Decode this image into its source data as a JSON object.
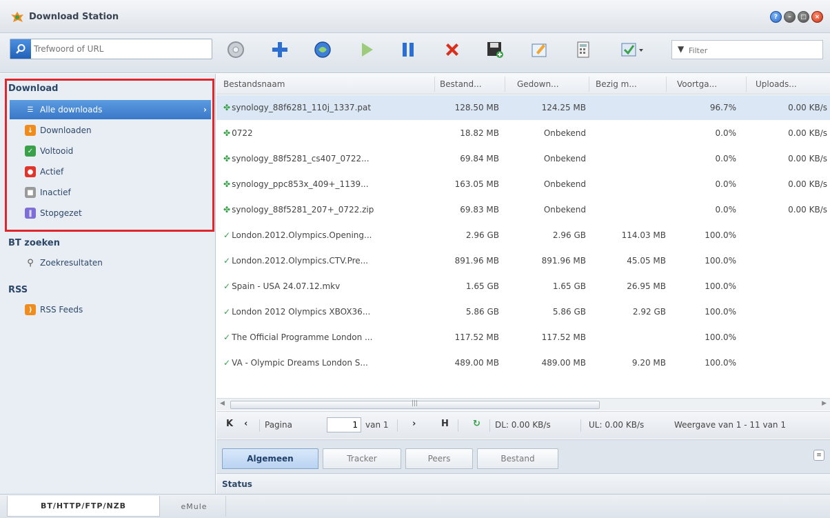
{
  "window": {
    "title": "Download Station",
    "controls": [
      "help",
      "minimize",
      "maximize",
      "close"
    ]
  },
  "toolbar": {
    "search_placeholder": "Trefwoord of URL",
    "filter_placeholder": "Filter",
    "icons": [
      "settings-icon",
      "add-icon",
      "url-icon",
      "resume-icon",
      "pause-icon",
      "delete-icon",
      "save-icon",
      "edit-icon",
      "calculator-icon",
      "select-dropdown-icon"
    ]
  },
  "sidebar": {
    "download": {
      "title": "Download",
      "items": [
        {
          "label": "Alle downloads",
          "icon": "list-icon",
          "color": "#5b9be0"
        },
        {
          "label": "Downloaden",
          "icon": "download-icon",
          "color": "#f08b1d"
        },
        {
          "label": "Voltooid",
          "icon": "check-icon",
          "color": "#3aa14a"
        },
        {
          "label": "Actief",
          "icon": "active-icon",
          "color": "#e0352a"
        },
        {
          "label": "Inactief",
          "icon": "inactive-icon",
          "color": "#9a9a9a"
        },
        {
          "label": "Stopgezet",
          "icon": "pause-icon",
          "color": "#7e6fd6"
        }
      ]
    },
    "bt": {
      "title": "BT zoeken",
      "items": [
        {
          "label": "Zoekresultaten",
          "icon": "search-icon"
        }
      ]
    },
    "rss": {
      "title": "RSS",
      "items": [
        {
          "label": "RSS Feeds",
          "icon": "rss-icon",
          "color": "#f08b1d"
        }
      ]
    }
  },
  "table": {
    "columns": [
      "Bestandsnaam",
      "Bestand...",
      "Gedown...",
      "Bezig m...",
      "Voortga...",
      "Uploads..."
    ],
    "rows": [
      {
        "status": "active",
        "name": "synology_88f6281_110j_1337.pat",
        "size": "128.50 MB",
        "downloaded": "124.25 MB",
        "busy": "",
        "progress": "96.7%",
        "upload": "0.00 KB/s"
      },
      {
        "status": "active",
        "name": "0722",
        "size": "18.82 MB",
        "downloaded": "Onbekend",
        "busy": "",
        "progress": "0.0%",
        "upload": "0.00 KB/s"
      },
      {
        "status": "active",
        "name": "synology_88f5281_cs407_0722...",
        "size": "69.84 MB",
        "downloaded": "Onbekend",
        "busy": "",
        "progress": "0.0%",
        "upload": "0.00 KB/s"
      },
      {
        "status": "active",
        "name": "synology_ppc853x_409+_1139...",
        "size": "163.05 MB",
        "downloaded": "Onbekend",
        "busy": "",
        "progress": "0.0%",
        "upload": "0.00 KB/s"
      },
      {
        "status": "active",
        "name": "synology_88f5281_207+_0722.zip",
        "size": "69.83 MB",
        "downloaded": "Onbekend",
        "busy": "",
        "progress": "0.0%",
        "upload": "0.00 KB/s"
      },
      {
        "status": "done",
        "name": "London.2012.Olympics.Opening...",
        "size": "2.96 GB",
        "downloaded": "2.96 GB",
        "busy": "114.03 MB",
        "progress": "100.0%",
        "upload": ""
      },
      {
        "status": "done",
        "name": "London.2012.Olympics.CTV.Pre...",
        "size": "891.96 MB",
        "downloaded": "891.96 MB",
        "busy": "45.05 MB",
        "progress": "100.0%",
        "upload": ""
      },
      {
        "status": "done",
        "name": "Spain - USA 24.07.12.mkv",
        "size": "1.65 GB",
        "downloaded": "1.65 GB",
        "busy": "26.95 MB",
        "progress": "100.0%",
        "upload": ""
      },
      {
        "status": "done",
        "name": "London 2012 Olympics XBOX36...",
        "size": "5.86 GB",
        "downloaded": "5.86 GB",
        "busy": "2.92 GB",
        "progress": "100.0%",
        "upload": ""
      },
      {
        "status": "done",
        "name": "The Official Programme London ...",
        "size": "117.52 MB",
        "downloaded": "117.52 MB",
        "busy": "",
        "progress": "100.0%",
        "upload": ""
      },
      {
        "status": "done",
        "name": "VA - Olympic Dreams London S...",
        "size": "489.00 MB",
        "downloaded": "489.00 MB",
        "busy": "9.20 MB",
        "progress": "100.0%",
        "upload": ""
      }
    ]
  },
  "pager": {
    "page_label": "Pagina",
    "page_value": "1",
    "of_label": "van 1",
    "dl": "DL: 0.00 KB/s",
    "ul": "UL: 0.00 KB/s",
    "display": "Weergave van 1 - 11 van 1"
  },
  "detail": {
    "tabs": [
      "Algemeen",
      "Tracker",
      "Peers",
      "Bestand"
    ],
    "status_label": "Status"
  },
  "bottom_tabs": [
    "BT/HTTP/FTP/NZB",
    "eMule"
  ]
}
